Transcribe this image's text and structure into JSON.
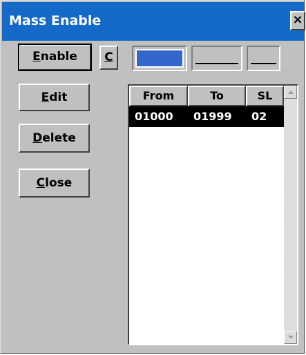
{
  "window": {
    "title": "Mass Enable",
    "close_label": "×"
  },
  "buttons": {
    "enable": {
      "label_u": "E",
      "label_rest": "nable"
    },
    "c": {
      "label_u": "C",
      "label_rest": ""
    },
    "edit": {
      "label_pre": "",
      "label_u": "E",
      "label_rest": "dit"
    },
    "delete": {
      "label_u": "D",
      "label_rest": "elete"
    },
    "close": {
      "label_u": "C",
      "label_rest": "lose"
    }
  },
  "list": {
    "columns": [
      "From",
      "To",
      "SL"
    ],
    "rows": [
      {
        "from": "01000",
        "to": "01999",
        "sl": "02",
        "selected": true
      }
    ]
  },
  "colors": {
    "titlebar": "#1569c7",
    "selection": "#000000",
    "swatch": "#3566cc"
  }
}
